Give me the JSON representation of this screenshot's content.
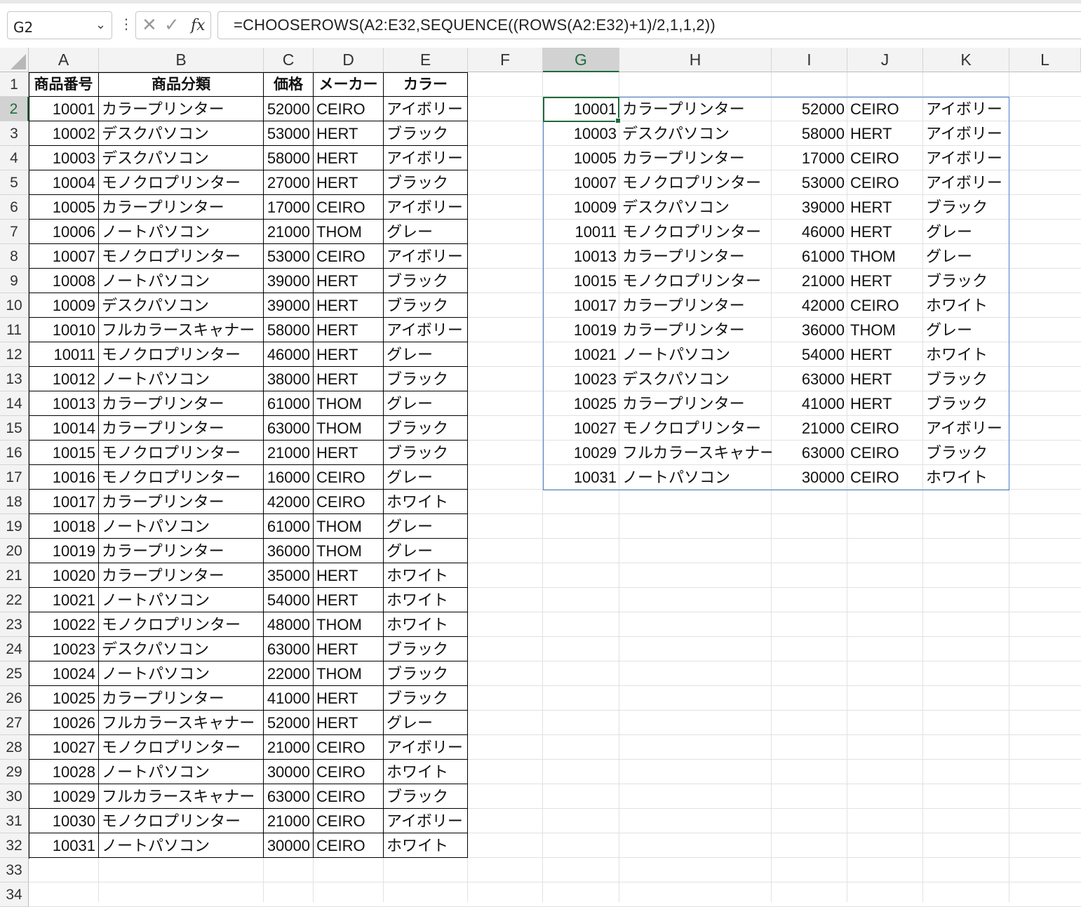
{
  "formula_bar": {
    "name_box": "G2",
    "formula": "=CHOOSEROWS(A2:E32,SEQUENCE((ROWS(A2:E32)+1)/2,1,1,2))",
    "icons": [
      "more-options-icon",
      "cancel-icon",
      "enter-icon",
      "function-icon"
    ]
  },
  "columns": [
    "A",
    "B",
    "C",
    "D",
    "E",
    "F",
    "G",
    "H",
    "I",
    "J",
    "K",
    "L"
  ],
  "selected_column": "G",
  "row_numbers": [
    "1",
    "2",
    "3",
    "4",
    "5",
    "6",
    "7",
    "8",
    "9",
    "10",
    "11",
    "12",
    "13",
    "14",
    "15",
    "16",
    "17",
    "18",
    "19",
    "20",
    "21",
    "22",
    "23",
    "24",
    "25",
    "26",
    "27",
    "28",
    "29",
    "30",
    "31",
    "32",
    "33",
    "34"
  ],
  "selected_row": "2",
  "source_table": {
    "headers": [
      "商品番号",
      "商品分類",
      "価格",
      "メーカー",
      "カラー"
    ],
    "rows": [
      [
        "10001",
        "カラープリンター",
        "52000",
        "CEIRO",
        "アイボリー"
      ],
      [
        "10002",
        "デスクパソコン",
        "53000",
        "HERT",
        "ブラック"
      ],
      [
        "10003",
        "デスクパソコン",
        "58000",
        "HERT",
        "アイボリー"
      ],
      [
        "10004",
        "モノクロプリンター",
        "27000",
        "HERT",
        "ブラック"
      ],
      [
        "10005",
        "カラープリンター",
        "17000",
        "CEIRO",
        "アイボリー"
      ],
      [
        "10006",
        "ノートパソコン",
        "21000",
        "THOM",
        "グレー"
      ],
      [
        "10007",
        "モノクロプリンター",
        "53000",
        "CEIRO",
        "アイボリー"
      ],
      [
        "10008",
        "ノートパソコン",
        "39000",
        "HERT",
        "ブラック"
      ],
      [
        "10009",
        "デスクパソコン",
        "39000",
        "HERT",
        "ブラック"
      ],
      [
        "10010",
        "フルカラースキャナー",
        "58000",
        "HERT",
        "アイボリー"
      ],
      [
        "10011",
        "モノクロプリンター",
        "46000",
        "HERT",
        "グレー"
      ],
      [
        "10012",
        "ノートパソコン",
        "38000",
        "HERT",
        "ブラック"
      ],
      [
        "10013",
        "カラープリンター",
        "61000",
        "THOM",
        "グレー"
      ],
      [
        "10014",
        "カラープリンター",
        "63000",
        "THOM",
        "ブラック"
      ],
      [
        "10015",
        "モノクロプリンター",
        "21000",
        "HERT",
        "ブラック"
      ],
      [
        "10016",
        "モノクロプリンター",
        "16000",
        "CEIRO",
        "グレー"
      ],
      [
        "10017",
        "カラープリンター",
        "42000",
        "CEIRO",
        "ホワイト"
      ],
      [
        "10018",
        "ノートパソコン",
        "61000",
        "THOM",
        "グレー"
      ],
      [
        "10019",
        "カラープリンター",
        "36000",
        "THOM",
        "グレー"
      ],
      [
        "10020",
        "カラープリンター",
        "35000",
        "HERT",
        "ホワイト"
      ],
      [
        "10021",
        "ノートパソコン",
        "54000",
        "HERT",
        "ホワイト"
      ],
      [
        "10022",
        "モノクロプリンター",
        "48000",
        "THOM",
        "ホワイト"
      ],
      [
        "10023",
        "デスクパソコン",
        "63000",
        "HERT",
        "ブラック"
      ],
      [
        "10024",
        "ノートパソコン",
        "22000",
        "THOM",
        "ブラック"
      ],
      [
        "10025",
        "カラープリンター",
        "41000",
        "HERT",
        "ブラック"
      ],
      [
        "10026",
        "フルカラースキャナー",
        "52000",
        "HERT",
        "グレー"
      ],
      [
        "10027",
        "モノクロプリンター",
        "21000",
        "CEIRO",
        "アイボリー"
      ],
      [
        "10028",
        "ノートパソコン",
        "30000",
        "CEIRO",
        "ホワイト"
      ],
      [
        "10029",
        "フルカラースキャナー",
        "63000",
        "CEIRO",
        "ブラック"
      ],
      [
        "10030",
        "モノクロプリンター",
        "21000",
        "CEIRO",
        "アイボリー"
      ],
      [
        "10031",
        "ノートパソコン",
        "30000",
        "CEIRO",
        "ホワイト"
      ]
    ]
  },
  "spill_table": {
    "rows": [
      [
        "10001",
        "カラープリンター",
        "52000",
        "CEIRO",
        "アイボリー"
      ],
      [
        "10003",
        "デスクパソコン",
        "58000",
        "HERT",
        "アイボリー"
      ],
      [
        "10005",
        "カラープリンター",
        "17000",
        "CEIRO",
        "アイボリー"
      ],
      [
        "10007",
        "モノクロプリンター",
        "53000",
        "CEIRO",
        "アイボリー"
      ],
      [
        "10009",
        "デスクパソコン",
        "39000",
        "HERT",
        "ブラック"
      ],
      [
        "10011",
        "モノクロプリンター",
        "46000",
        "HERT",
        "グレー"
      ],
      [
        "10013",
        "カラープリンター",
        "61000",
        "THOM",
        "グレー"
      ],
      [
        "10015",
        "モノクロプリンター",
        "21000",
        "HERT",
        "ブラック"
      ],
      [
        "10017",
        "カラープリンター",
        "42000",
        "CEIRO",
        "ホワイト"
      ],
      [
        "10019",
        "カラープリンター",
        "36000",
        "THOM",
        "グレー"
      ],
      [
        "10021",
        "ノートパソコン",
        "54000",
        "HERT",
        "ホワイト"
      ],
      [
        "10023",
        "デスクパソコン",
        "63000",
        "HERT",
        "ブラック"
      ],
      [
        "10025",
        "カラープリンター",
        "41000",
        "HERT",
        "ブラック"
      ],
      [
        "10027",
        "モノクロプリンター",
        "21000",
        "CEIRO",
        "アイボリー"
      ],
      [
        "10029",
        "フルカラースキャナー",
        "63000",
        "CEIRO",
        "ブラック"
      ],
      [
        "10031",
        "ノートパソコン",
        "30000",
        "CEIRO",
        "ホワイト"
      ]
    ]
  },
  "colors": {
    "selection_green": "#1e6b3d",
    "spill_border": "#4a7fc8",
    "header_bg": "#f3f3f3",
    "selected_header_bg": "#d2d2d2"
  }
}
